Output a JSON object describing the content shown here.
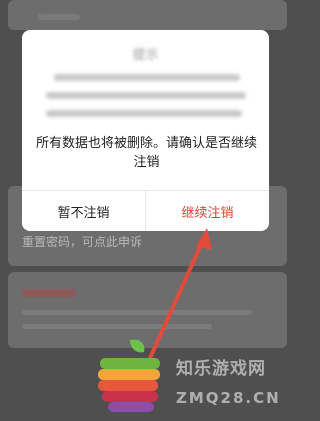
{
  "background": {
    "hint_text": "重置密码，可点此申诉"
  },
  "dialog": {
    "title": "提示",
    "message": "所有数据也将被删除。请确认是否继续注销",
    "cancel_label": "暂不注销",
    "confirm_label": "继续注销",
    "accent_color": "#e0413a"
  },
  "watermark": {
    "brand_cn": "知乐游戏网",
    "brand_en": "ZMQ28.CN",
    "logo": "apple-logo-icon"
  },
  "annotation": {
    "arrow": "red-arrow-icon",
    "color": "#e24a3b"
  }
}
